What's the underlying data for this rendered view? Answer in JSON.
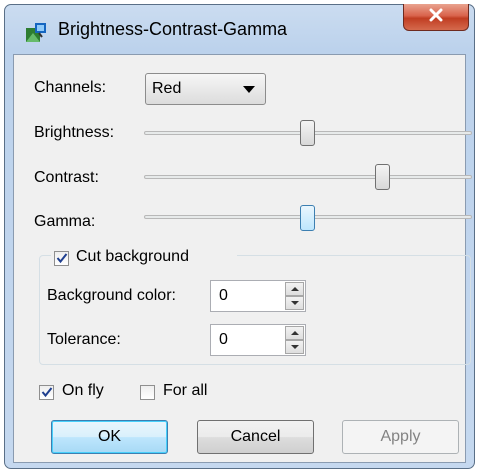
{
  "window": {
    "title": "Brightness-Contrast-Gamma",
    "close_glyph": "x"
  },
  "channels": {
    "label": "Channels:",
    "selected": "Red"
  },
  "sliders": {
    "brightness": {
      "label": "Brightness:",
      "value_fraction": 0.5
    },
    "contrast": {
      "label": "Contrast:",
      "value_fraction": 0.74
    },
    "gamma": {
      "label": "Gamma:",
      "value_fraction": 0.5
    }
  },
  "cut_background": {
    "label": "Cut background",
    "checked": true,
    "background_color": {
      "label": "Background color:",
      "value": "0"
    },
    "tolerance": {
      "label": "Tolerance:",
      "value": "0"
    }
  },
  "options": {
    "on_fly": {
      "label": "On fly",
      "checked": true
    },
    "for_all": {
      "label": "For all",
      "checked": false
    }
  },
  "buttons": {
    "ok": "OK",
    "cancel": "Cancel",
    "apply": "Apply"
  },
  "icons": {
    "app": "image-adjust-icon",
    "close": "close-icon"
  },
  "colors": {
    "accent": "#3c7fb1",
    "close_red": "#c03d22"
  }
}
